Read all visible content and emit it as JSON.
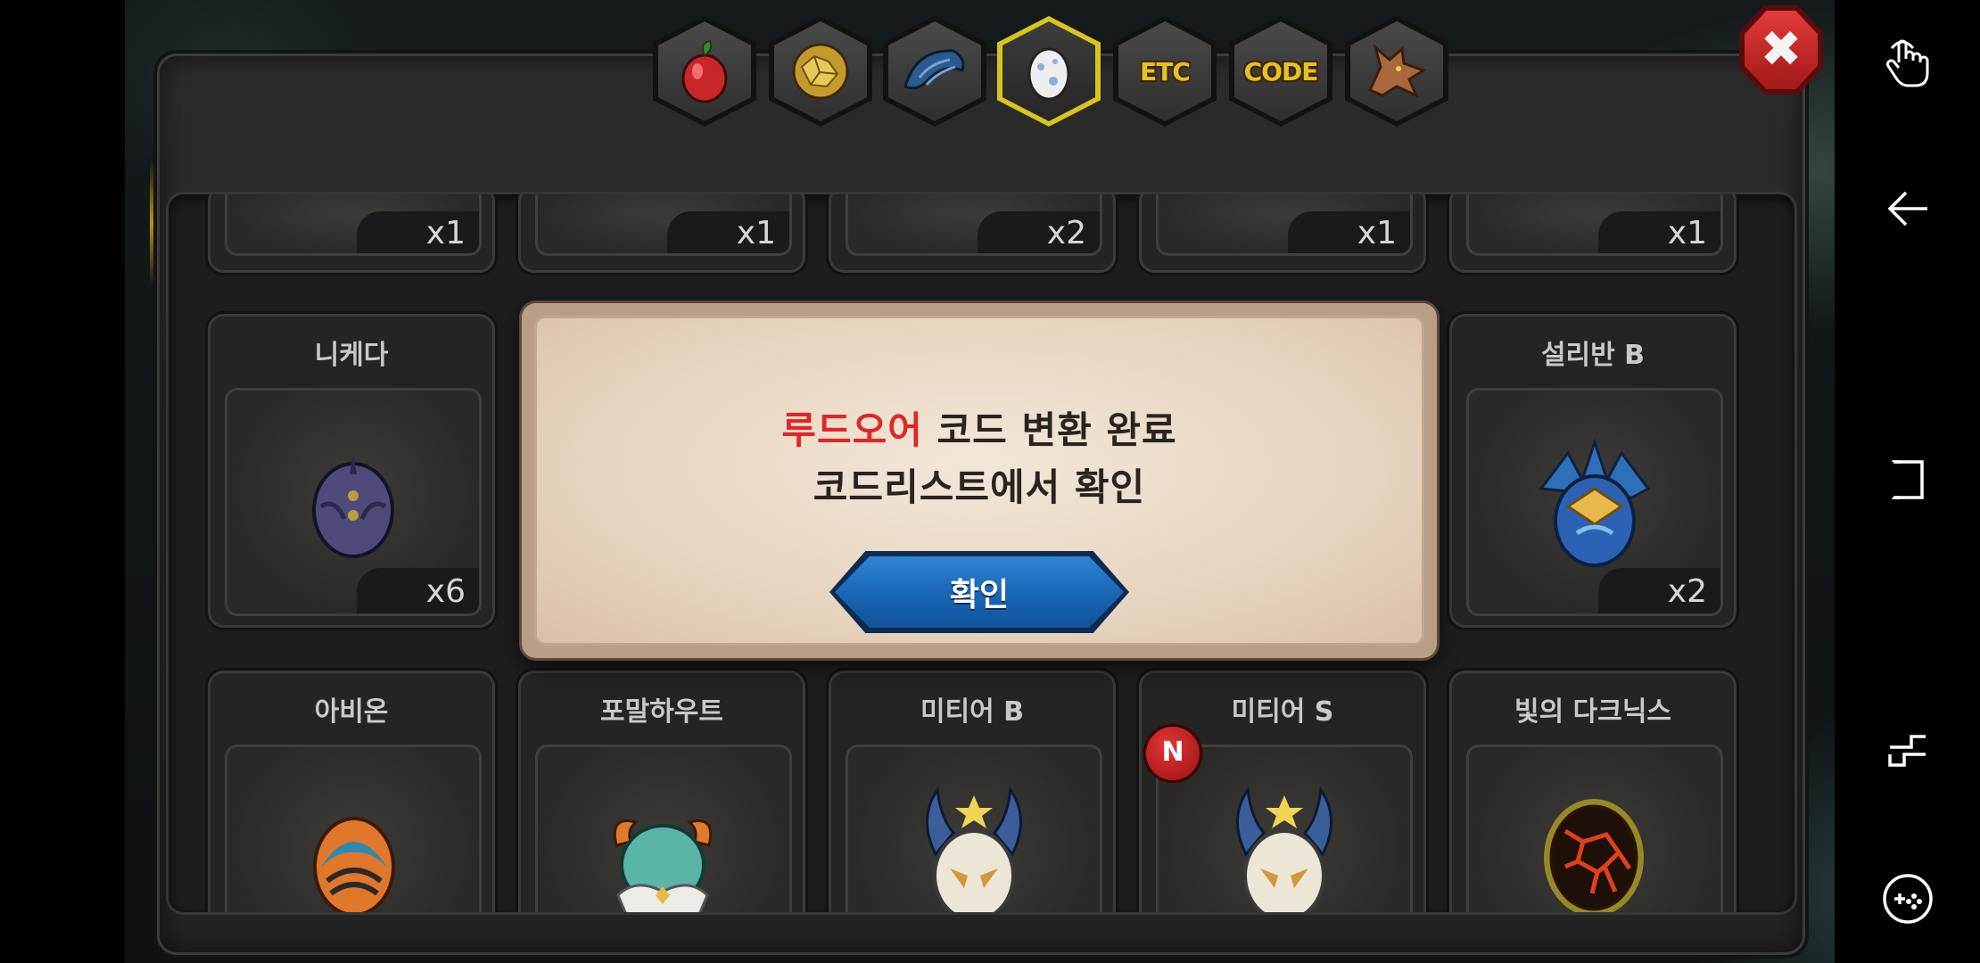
{
  "tabs": [
    {
      "name": "fruit",
      "icon": "red-fruit-icon",
      "label": ""
    },
    {
      "name": "ore",
      "icon": "gold-ore-icon",
      "label": ""
    },
    {
      "name": "scale",
      "icon": "blue-scale-icon",
      "label": ""
    },
    {
      "name": "egg",
      "icon": "egg-icon",
      "label": "",
      "active": true
    },
    {
      "name": "etc",
      "icon": "",
      "label": "ETC"
    },
    {
      "name": "code",
      "icon": "",
      "label": "CODE"
    },
    {
      "name": "dragon",
      "icon": "dragon-head-icon",
      "label": ""
    }
  ],
  "close_label": "✖",
  "top_row": [
    {
      "qty": "x1"
    },
    {
      "qty": "x1"
    },
    {
      "qty": "x2"
    },
    {
      "qty": "x1"
    },
    {
      "qty": "x1"
    }
  ],
  "middle_row": [
    {
      "name": "니케다",
      "qty": "x6",
      "egg": "dark-purple-egg"
    },
    {
      "name": "설리반 B",
      "qty": "x2",
      "egg": "blue-feather-egg"
    }
  ],
  "bottom_row": [
    {
      "name": "아비온",
      "egg": "orange-blue-egg"
    },
    {
      "name": "포말하우트",
      "egg": "teal-horned-egg"
    },
    {
      "name": "미티어 B",
      "egg": "horned-mask-egg"
    },
    {
      "name": "미티어 S",
      "egg": "horned-mask-egg",
      "badge": "N"
    },
    {
      "name": "빛의 다크닉스",
      "egg": "lava-egg"
    }
  ],
  "dialog": {
    "highlight": "루드오어",
    "line1_rest": " 코드 변환 완료",
    "line2": "코드리스트에서 확인",
    "button": "확인"
  },
  "colors": {
    "highlight": "#e02626",
    "button": "#1a67b6",
    "close": "#c42222",
    "tab_active_border": "#d8c41c"
  },
  "nav": [
    "gesture-icon",
    "back-icon",
    "recents-icon",
    "overview-icon",
    "game-tools-icon"
  ]
}
